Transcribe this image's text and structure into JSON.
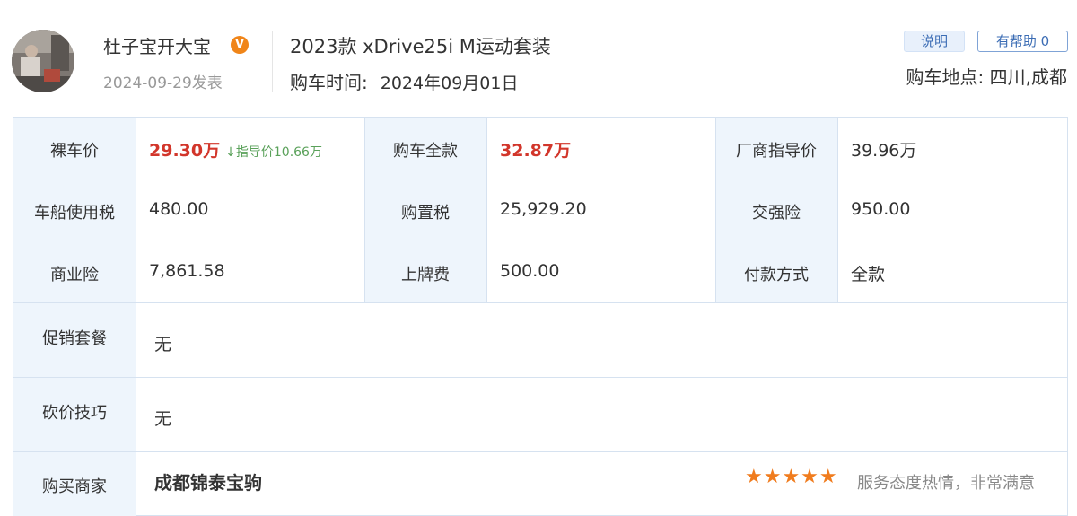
{
  "user": {
    "name": "杜子宝开大宝",
    "badge": "V",
    "date": "2024-09-29发表"
  },
  "car": {
    "model": "2023款 xDrive25i M运动套装",
    "purchase_time_label": "购车时间:",
    "purchase_time_value": "2024年09月01日"
  },
  "actions": {
    "explain_label": "说明",
    "helpful_label": "有帮助 0"
  },
  "location": "购车地点: 四川,成都",
  "table": {
    "bare_price_label": "裸车价",
    "bare_price_value": "29.30万",
    "guide_drop": "↓指导价10.66万",
    "full_price_label": "购车全款",
    "full_price_value": "32.87万",
    "msrp_label": "厂商指导价",
    "msrp_value": "39.96万",
    "vehicle_tax_label": "车船使用税",
    "vehicle_tax_value": "480.00",
    "purchase_tax_label": "购置税",
    "purchase_tax_value": "25,929.20",
    "compulsory_ins_label": "交强险",
    "compulsory_ins_value": "950.00",
    "commercial_ins_label": "商业险",
    "commercial_ins_value": "7,861.58",
    "plate_fee_label": "上牌费",
    "plate_fee_value": "500.00",
    "payment_label": "付款方式",
    "payment_value": "全款",
    "promo_label": "促销套餐",
    "promo_value": "无",
    "bargain_label": "砍价技巧",
    "bargain_value": "无",
    "dealer_label": "购买商家",
    "dealer_value": "成都锦泰宝驹",
    "dealer_rating": "★★★★★",
    "dealer_comment": "服务态度热情，非常满意"
  },
  "colors": {
    "accent_red": "#d2362b",
    "star_orange": "#f07c1e",
    "guide_green": "#5aa15a",
    "label_bg": "#eef5fc",
    "border": "#d6e2f0"
  }
}
